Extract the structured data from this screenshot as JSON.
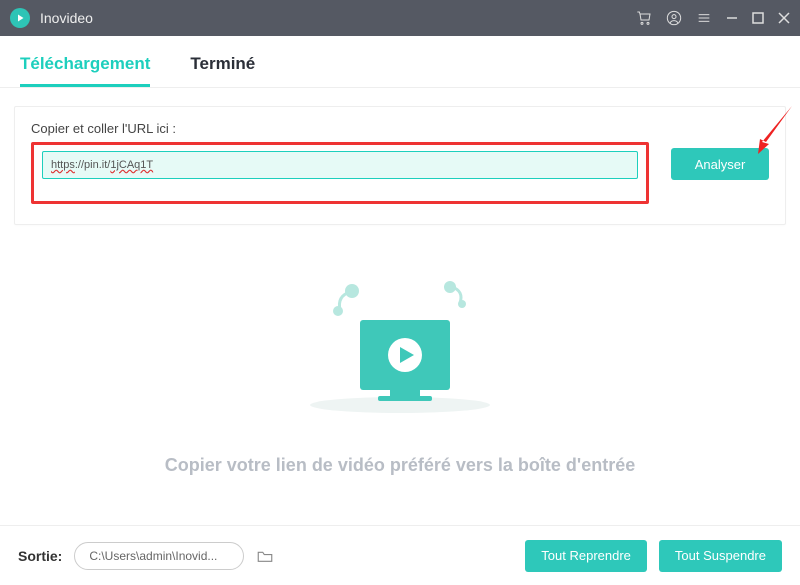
{
  "titlebar": {
    "app_name": "Inovideo"
  },
  "tabs": {
    "download": "Téléchargement",
    "done": "Terminé"
  },
  "url_section": {
    "label": "Copier et coller l'URL ici :",
    "input_value_proto": "https",
    "input_value_mid": "://pin.it/",
    "input_value_slug": "1jCAq1T",
    "analyze": "Analyser"
  },
  "placeholder": "Copier votre lien de vidéo préféré vers la boîte d'entrée",
  "footer": {
    "label": "Sortie:",
    "path": "C:\\Users\\admin\\Inovid...",
    "resume_all": "Tout Reprendre",
    "suspend_all": "Tout Suspendre"
  }
}
